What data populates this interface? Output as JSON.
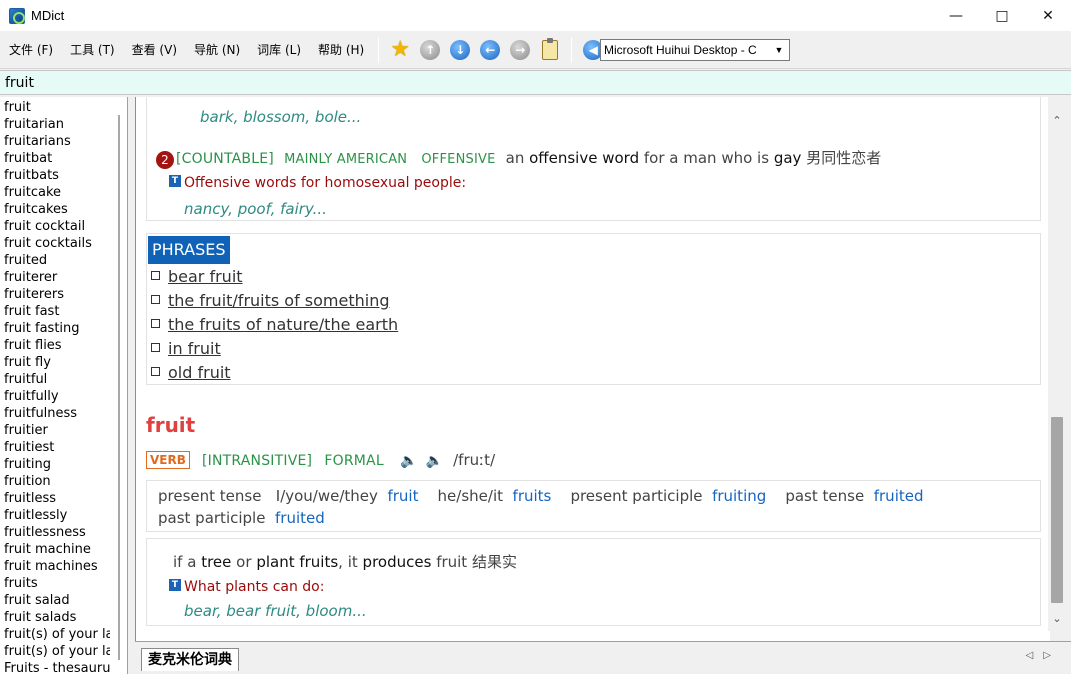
{
  "window": {
    "title": "MDict"
  },
  "menu": [
    "文件 (F)",
    "工具 (T)",
    "查看 (V)",
    "导航 (N)",
    "词库 (L)",
    "帮助 (H)"
  ],
  "dictionary_selector": {
    "selected": "Microsoft Huihui Desktop - C"
  },
  "search": {
    "value": "fruit"
  },
  "word_list": [
    "fruit",
    "fruitarian",
    "fruitarians",
    "fruitbat",
    "fruitbats",
    "fruitcake",
    "fruitcakes",
    "fruit cocktail",
    "fruit cocktails",
    "fruited",
    "fruiterer",
    "fruiterers",
    "fruit fast",
    "fruit fasting",
    "fruit flies",
    "fruit fly",
    "fruitful",
    "fruitfully",
    "fruitfulness",
    "fruitier",
    "fruitiest",
    "fruiting",
    "fruition",
    "fruitless",
    "fruitlessly",
    "fruitlessness",
    "fruit machine",
    "fruit machines",
    "fruits",
    "fruit salad",
    "fruit salads",
    "fruit(s) of your lal",
    "fruit(s) of your lal",
    "Fruits - thesaurus"
  ],
  "entry": {
    "top_examples": "bark, blossom, bole...",
    "sense2": {
      "num": "2",
      "grammar": "[COUNTABLE]",
      "region": "MAINLY AMERICAN",
      "register": "OFFENSIVE",
      "def_pre": "an",
      "def_bold1": "offensive word",
      "def_mid": "for a man who is",
      "def_bold2": "gay",
      "def_cn": "男同性恋者",
      "thesaurus_label": "Offensive words for homosexual people:",
      "thesaurus_examples": "nancy, poof, fairy..."
    },
    "phrases_title": "PHRASES",
    "phrases": [
      "bear fruit",
      "the fruit/fruits of something",
      "the fruits of nature/the earth",
      "in fruit",
      "old fruit"
    ],
    "headword": "fruit",
    "pos": "VERB",
    "verb_grammar": "[INTRANSITIVE]",
    "verb_register": "FORMAL",
    "pronunciation": "/fruːt/",
    "forms": {
      "present_tense_label": "present tense",
      "present_tense_persons": "I/you/we/they",
      "present_tense_value": "fruit",
      "third_person_label": "he/she/it",
      "third_person_value": "fruits",
      "present_participle_label": "present participle",
      "present_participle_value": "fruiting",
      "past_tense_label": "past tense",
      "past_tense_value": "fruited",
      "past_participle_label": "past participle",
      "past_participle_value": "fruited"
    },
    "verb_sense": {
      "def_pre": "if a",
      "def_b1": "tree",
      "def_or": "or",
      "def_b2": "plant fruits",
      "def_mid": ", it",
      "def_b3": "produces",
      "def_end": "fruit",
      "def_cn": "结果实",
      "thesaurus_label": "What plants can do:",
      "thesaurus_examples": "bear, bear fruit, bloom..."
    }
  },
  "tabs": [
    "麦克米伦词典"
  ]
}
